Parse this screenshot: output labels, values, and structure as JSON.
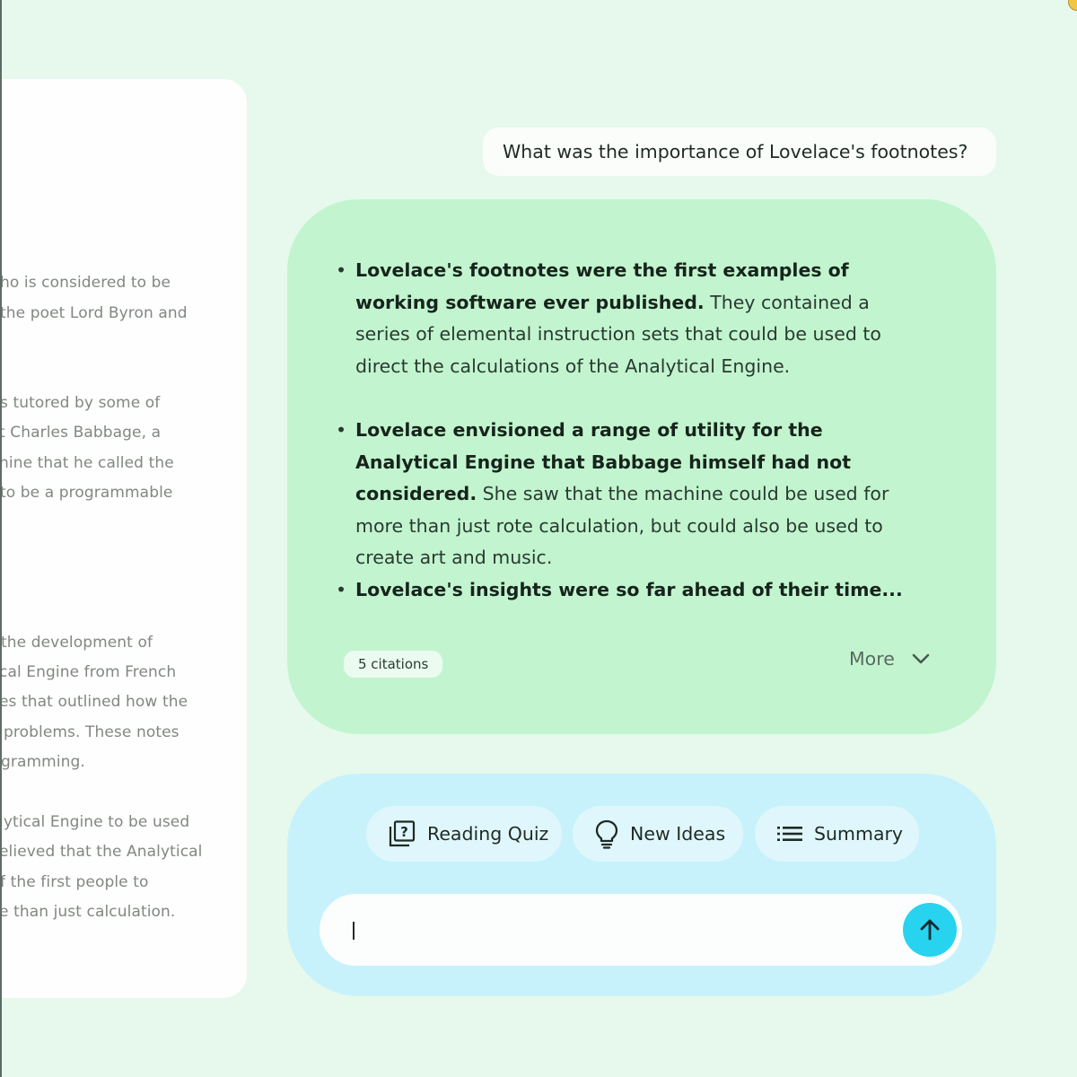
{
  "document_panel": {
    "lines": [
      "ho is considered to be",
      "the poet Lord Byron and",
      "s tutored by some of",
      "t Charles Babbage, a",
      "hine that he called the",
      "to be a programmable",
      "the development of",
      "cal Engine from French",
      "es that outlined how the",
      "problems. These notes",
      "gramming.",
      "lytical Engine to be used",
      "elieved that the Analytical",
      "f the first people to",
      "e than just calculation."
    ]
  },
  "conversation": {
    "user_query": "What was the importance of Lovelace's footnotes?",
    "response": {
      "bullets": [
        {
          "bold": "Lovelace's footnotes were the first examples of working software ever published.",
          "text": " They contained a series of elemental instruction sets that could be used to direct the calculations of the Analytical Engine."
        },
        {
          "bold": "Lovelace envisioned a range of utility for the Analytical Engine that Babbage himself had not considered.",
          "text": " She saw that the machine could be used for more than just rote calculation, but could also be used to create art and music."
        },
        {
          "bold": "Lovelace's insights were so far ahead of their time...",
          "text": ""
        }
      ],
      "citations_label": "5 citations",
      "more_label": "More"
    }
  },
  "actions": {
    "reading_quiz": "Reading Quiz",
    "new_ideas": "New Ideas",
    "summary": "Summary"
  },
  "chat_input": {
    "value": ""
  },
  "icons": {
    "quiz": "quiz-icon",
    "ideas": "lightbulb-icon",
    "summary": "list-icon",
    "more": "chevron-down-icon",
    "send": "arrow-up-icon"
  },
  "colors": {
    "background": "#e6f9ec",
    "response_card": "#c2f5cf",
    "action_card": "#c8f2fb",
    "send_button": "#27d3ef"
  }
}
